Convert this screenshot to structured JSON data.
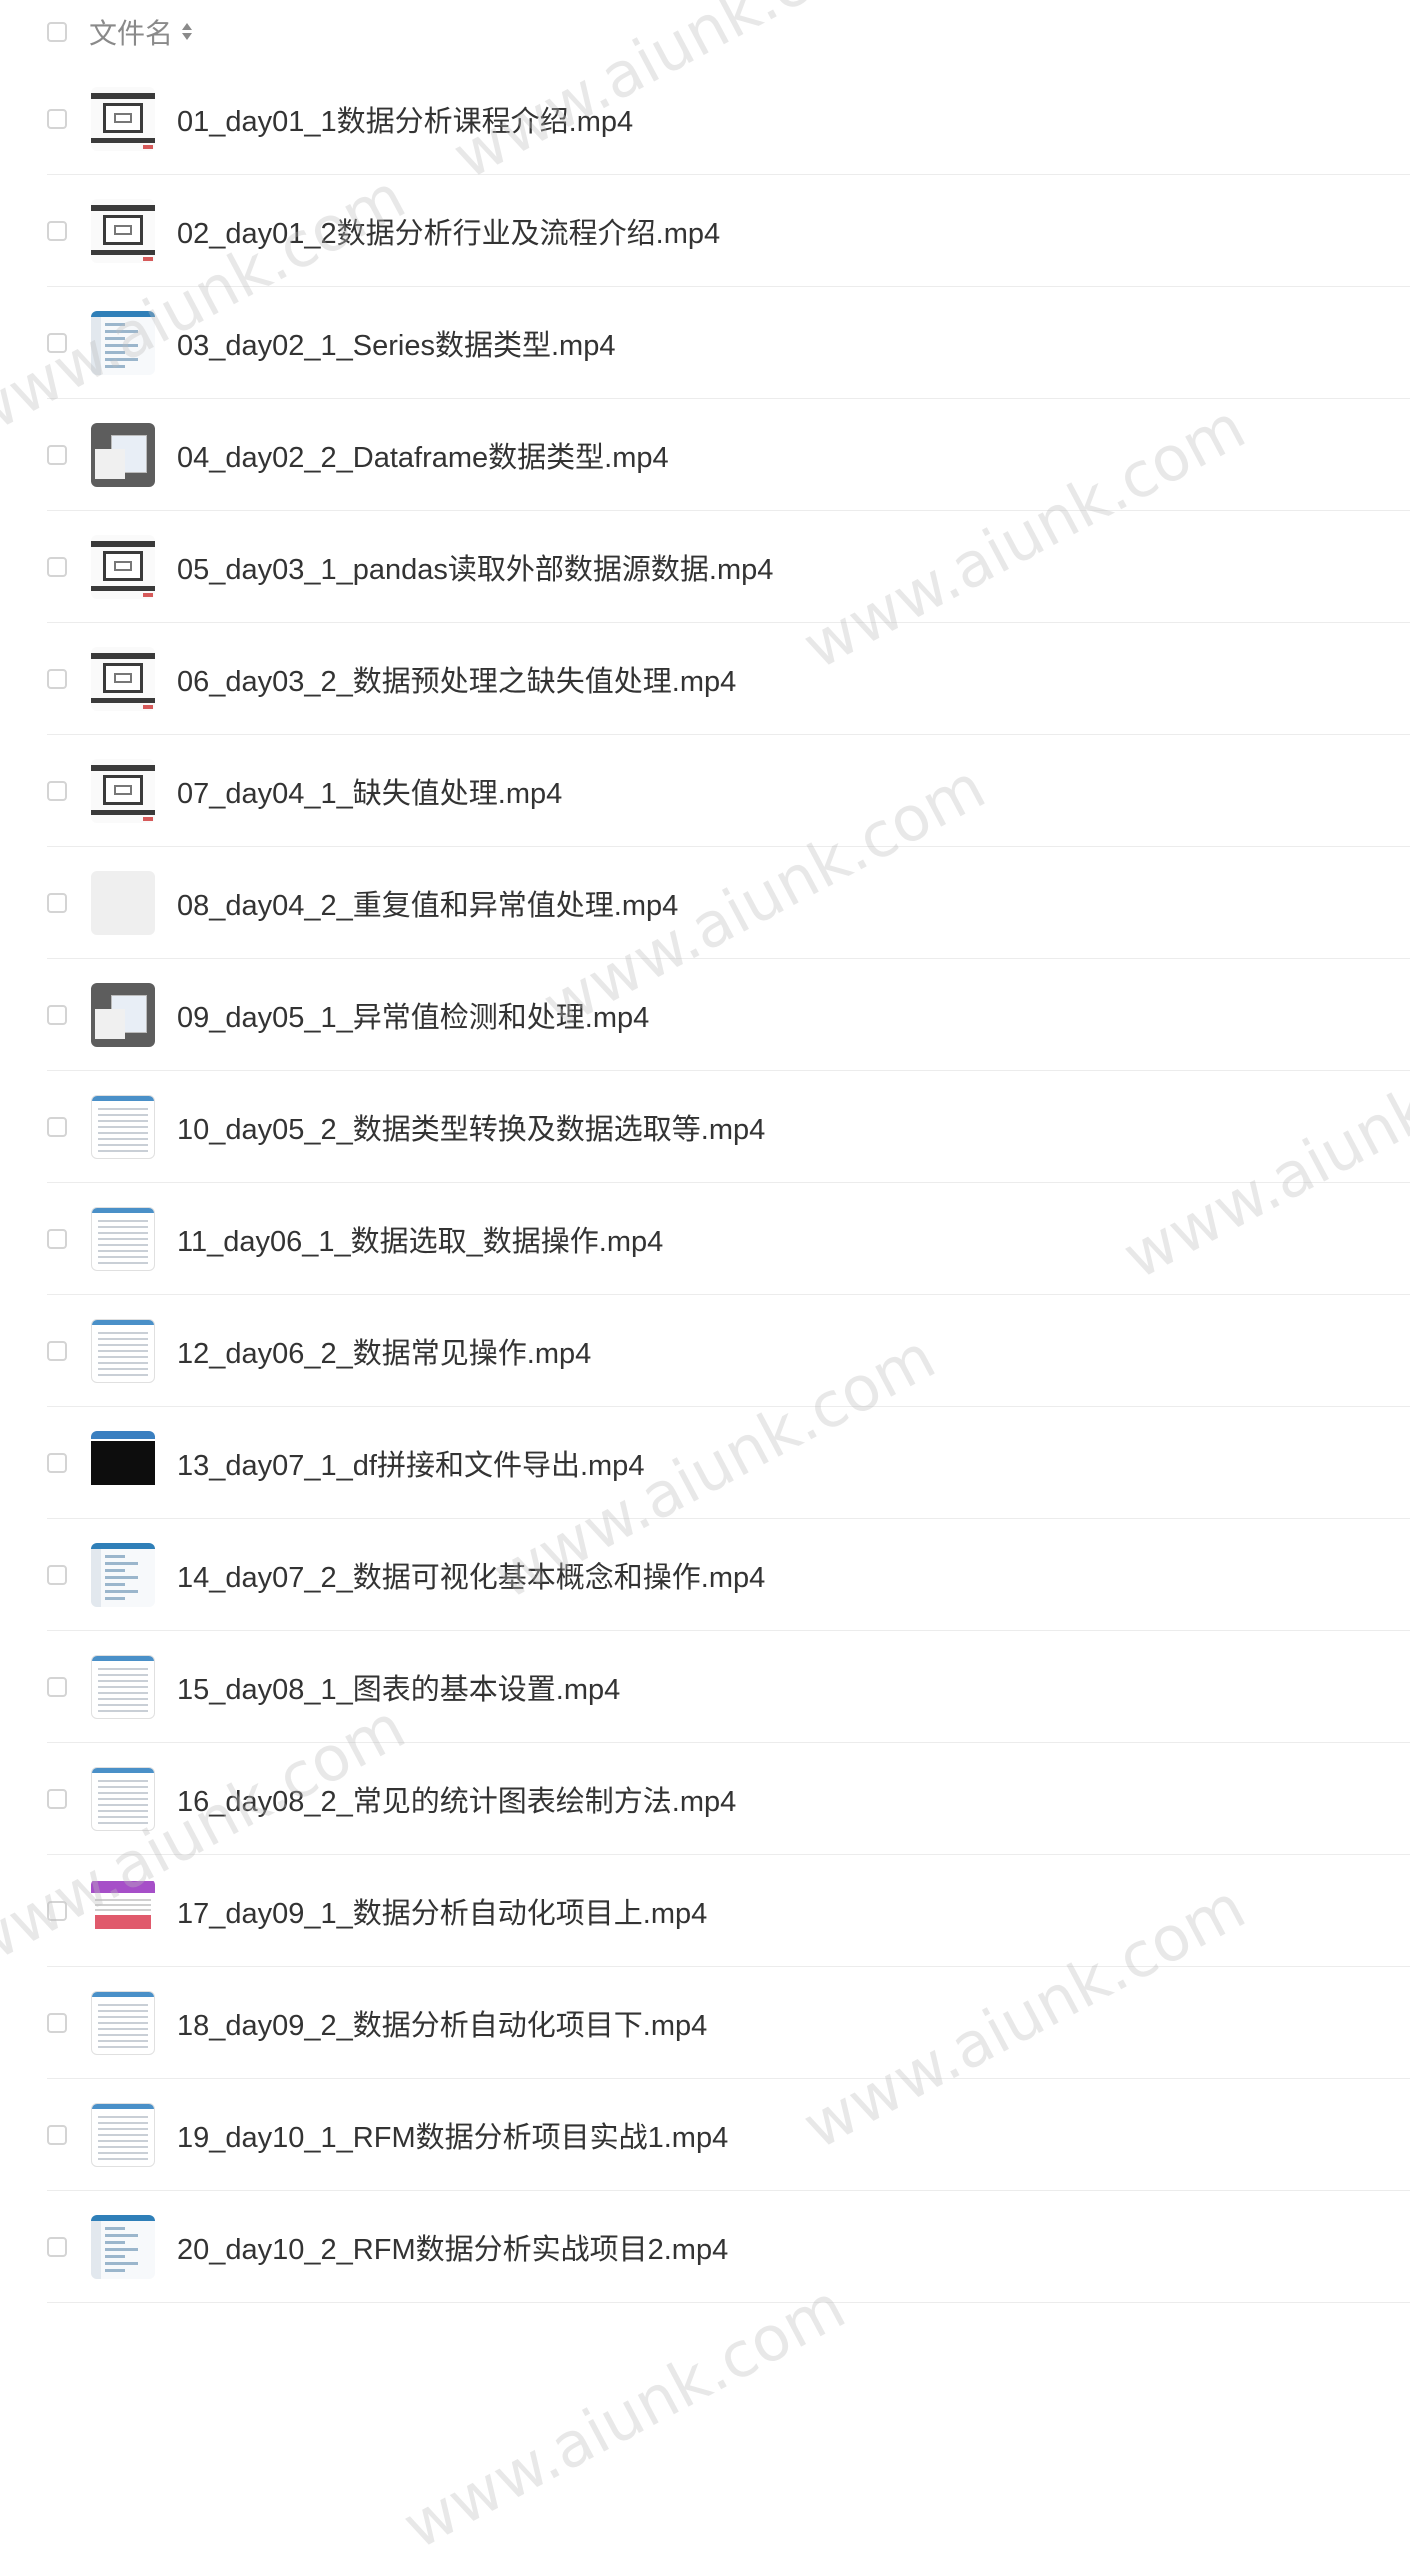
{
  "header": {
    "label": "文件名"
  },
  "files": [
    {
      "name": "01_day01_1数据分析课程介绍.mp4",
      "thumb": "slide"
    },
    {
      "name": "02_day01_2数据分析行业及流程介绍.mp4",
      "thumb": "slide"
    },
    {
      "name": "03_day02_1_Series数据类型.mp4",
      "thumb": "code"
    },
    {
      "name": "04_day02_2_Dataframe数据类型.mp4",
      "thumb": "gray"
    },
    {
      "name": "05_day03_1_pandas读取外部数据源数据.mp4",
      "thumb": "slide"
    },
    {
      "name": "06_day03_2_数据预处理之缺失值处理.mp4",
      "thumb": "slide"
    },
    {
      "name": "07_day04_1_缺失值处理.mp4",
      "thumb": "slide"
    },
    {
      "name": "08_day04_2_重复值和异常值处理.mp4",
      "thumb": "blank"
    },
    {
      "name": "09_day05_1_异常值检测和处理.mp4",
      "thumb": "gray"
    },
    {
      "name": "10_day05_2_数据类型转换及数据选取等.mp4",
      "thumb": "sheet"
    },
    {
      "name": "11_day06_1_数据选取_数据操作.mp4",
      "thumb": "sheet"
    },
    {
      "name": "12_day06_2_数据常见操作.mp4",
      "thumb": "sheet"
    },
    {
      "name": "13_day07_1_df拼接和文件导出.mp4",
      "thumb": "black"
    },
    {
      "name": "14_day07_2_数据可视化基本概念和操作.mp4",
      "thumb": "code"
    },
    {
      "name": "15_day08_1_图表的基本设置.mp4",
      "thumb": "sheet"
    },
    {
      "name": "16_day08_2_常见的统计图表绘制方法.mp4",
      "thumb": "sheet"
    },
    {
      "name": "17_day09_1_数据分析自动化项目上.mp4",
      "thumb": "purple"
    },
    {
      "name": "18_day09_2_数据分析自动化项目下.mp4",
      "thumb": "sheet"
    },
    {
      "name": "19_day10_1_RFM数据分析项目实战1.mp4",
      "thumb": "sheet"
    },
    {
      "name": "20_day10_2_RFM数据分析实战项目2.mp4",
      "thumb": "code"
    }
  ],
  "watermark": "www.aiunk.com"
}
